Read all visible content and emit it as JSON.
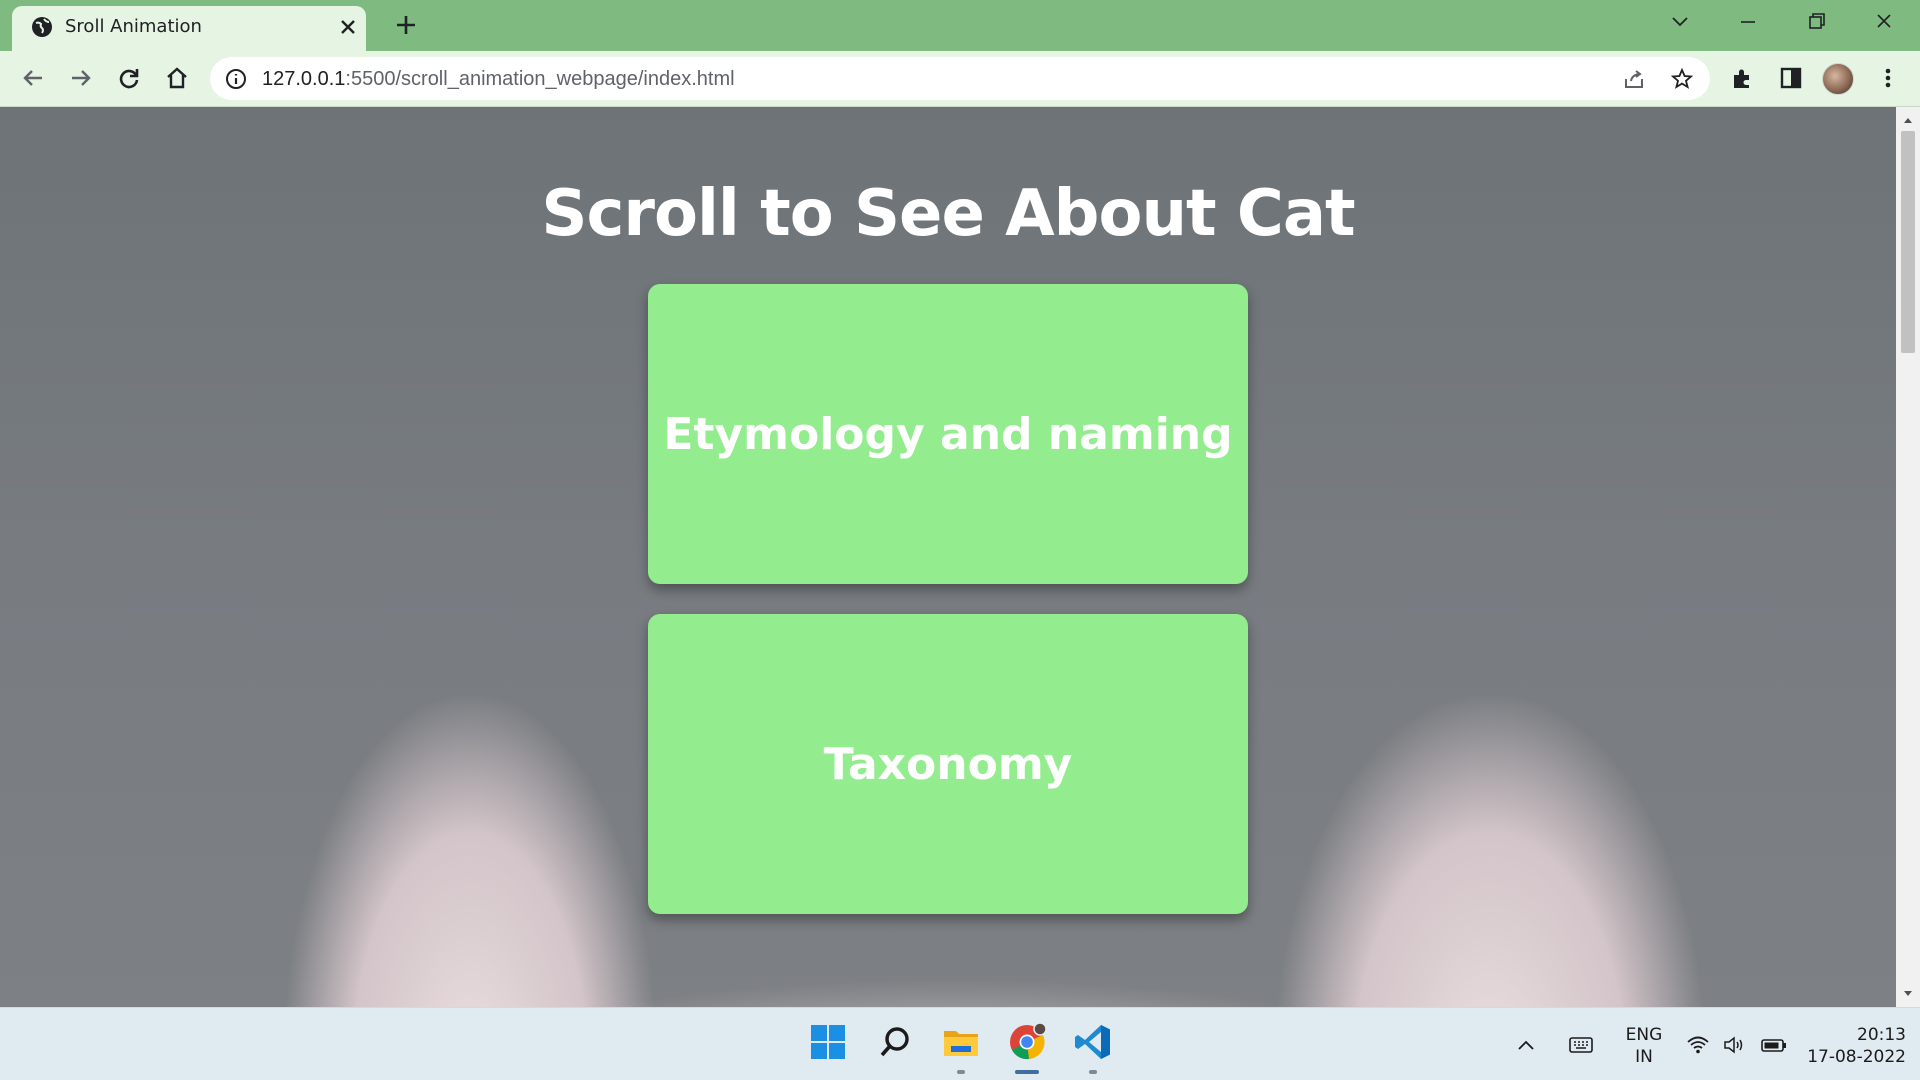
{
  "browser": {
    "tab_title": "Sroll Animation",
    "url_host": "127.0.0.1",
    "url_path": ":5500/scroll_animation_webpage/index.html"
  },
  "page": {
    "heading": "Scroll to See About Cat",
    "cards": [
      {
        "label": "Etymology and naming"
      },
      {
        "label": "Taxonomy"
      }
    ]
  },
  "taskbar": {
    "language_line1": "ENG",
    "language_line2": "IN",
    "time": "20:13",
    "date": "17-08-2022",
    "apps": [
      "start-icon",
      "search-icon",
      "file-explorer-icon",
      "chrome-icon",
      "vscode-icon"
    ]
  },
  "colors": {
    "card_bg": "#93ec8e",
    "chrome_frame": "#7fbb80",
    "toolbar_bg": "#e6f4e4"
  }
}
